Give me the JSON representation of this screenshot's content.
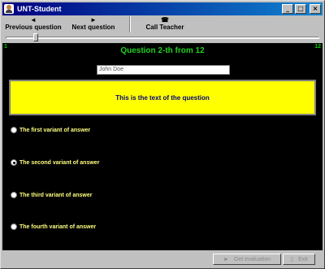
{
  "window": {
    "title": "UNT-Student"
  },
  "title_buttons": {
    "minimize": "_",
    "maximize": "□",
    "close": "×"
  },
  "toolbar": {
    "prev_label": "Previous question",
    "prev_icon": "◄",
    "next_label": "Next question",
    "next_icon": "►",
    "call_label": "Call Teacher",
    "call_icon": "☎"
  },
  "progress": {
    "min": "1",
    "max": "12",
    "current_fraction": 0.09
  },
  "question": {
    "title": "Question 2-th from 12",
    "student_name": "John Doe",
    "text": "This is the text of the question"
  },
  "answers": [
    {
      "label": "The first variant of answer",
      "checked": false
    },
    {
      "label": "The second variant of answer",
      "checked": true
    },
    {
      "label": "The third variant of answer",
      "checked": false
    },
    {
      "label": "The fourth variant of answer",
      "checked": false
    }
  ],
  "footer": {
    "evaluation_label": "Get evaluation",
    "evaluation_icon": "►",
    "exit_label": "Exit",
    "exit_icon": "▯"
  },
  "colors": {
    "background": "#000000",
    "question_title": "#20d020",
    "question_box": "#ffff00",
    "question_text": "#000080",
    "answer_text": "#ffff80"
  }
}
